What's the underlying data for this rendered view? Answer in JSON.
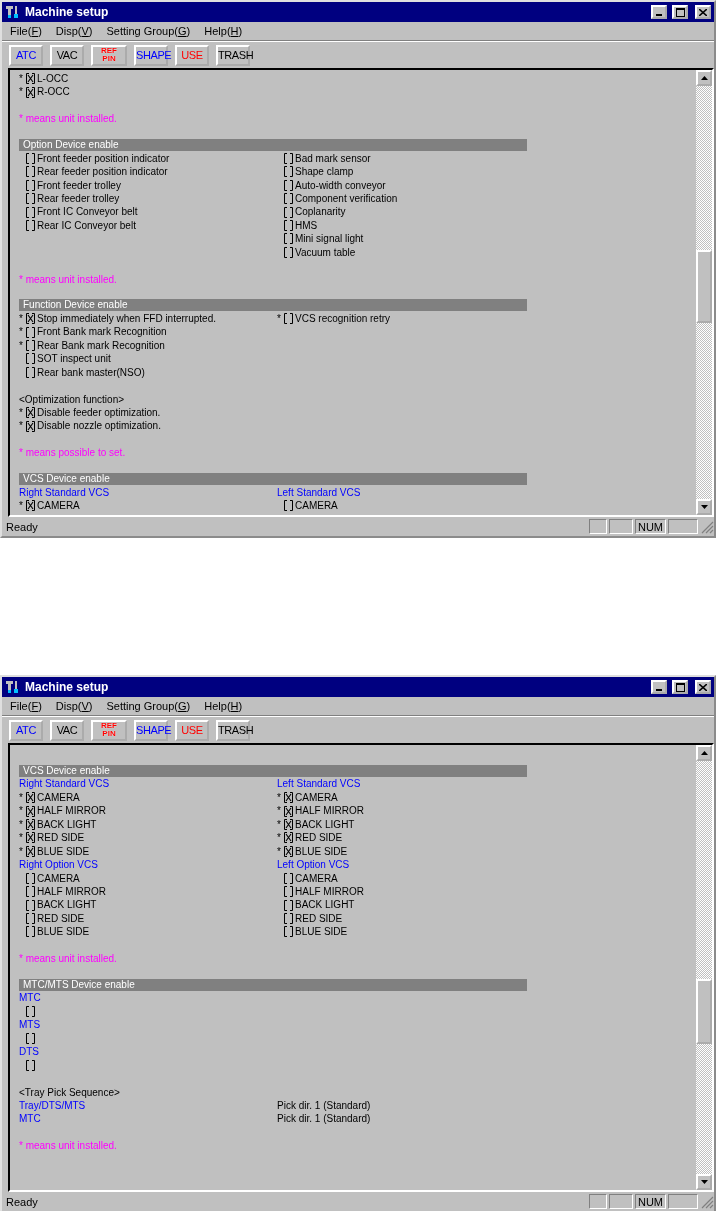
{
  "windows": [
    {
      "title": "Machine setup",
      "menu": [
        {
          "before": "File(",
          "key": "F",
          "after": ")"
        },
        {
          "before": "Disp(",
          "key": "V",
          "after": ")"
        },
        {
          "before": "Setting Group(",
          "key": "G",
          "after": ")"
        },
        {
          "before": "Help(",
          "key": "H",
          "after": ")"
        }
      ],
      "toolbar": [
        {
          "label": "ATC",
          "color": "#0000ff",
          "kind": "plain"
        },
        {
          "label": "VAC",
          "color": "#000000",
          "kind": "plain"
        },
        {
          "label": "REF PIN",
          "color": "#ff0000",
          "kind": "stacked"
        },
        {
          "label": "SHAPE",
          "color": "#0000ff",
          "kind": "plain"
        },
        {
          "label": "USE",
          "color": "#ff0000",
          "kind": "plain"
        },
        {
          "label": "TRASH",
          "color": "#000000",
          "kind": "plain"
        }
      ],
      "blocks": [
        [
          {
            "kind": "row",
            "cells": [
              {
                "kind": "check",
                "mark": "*",
                "checked": true,
                "label": "L-OCC"
              }
            ]
          },
          {
            "kind": "row",
            "cells": [
              {
                "kind": "check",
                "mark": "*",
                "checked": true,
                "label": "R-OCC"
              }
            ]
          }
        ],
        [
          {
            "kind": "row",
            "cells": [
              {
                "kind": "note",
                "text": "* means unit installed."
              }
            ]
          }
        ],
        [
          {
            "kind": "section",
            "title": "Option Device enable"
          },
          {
            "kind": "row",
            "cells": [
              {
                "kind": "check",
                "checked": false,
                "label": "Front feeder position indicator"
              },
              {
                "kind": "check",
                "checked": false,
                "label": "Bad mark sensor"
              }
            ]
          },
          {
            "kind": "row",
            "cells": [
              {
                "kind": "check",
                "checked": false,
                "label": "Rear feeder position indicator"
              },
              {
                "kind": "check",
                "checked": false,
                "label": "Shape clamp"
              }
            ]
          },
          {
            "kind": "row",
            "cells": [
              {
                "kind": "check",
                "checked": false,
                "label": "Front feeder trolley"
              },
              {
                "kind": "check",
                "checked": false,
                "label": "Auto-width conveyor"
              }
            ]
          },
          {
            "kind": "row",
            "cells": [
              {
                "kind": "check",
                "checked": false,
                "label": "Rear feeder trolley"
              },
              {
                "kind": "check",
                "checked": false,
                "label": "Component verification"
              }
            ]
          },
          {
            "kind": "row",
            "cells": [
              {
                "kind": "check",
                "checked": false,
                "label": "Front IC Conveyor belt"
              },
              {
                "kind": "check",
                "checked": false,
                "label": "Coplanarity"
              }
            ]
          },
          {
            "kind": "row",
            "cells": [
              {
                "kind": "check",
                "checked": false,
                "label": "Rear IC Conveyor belt"
              },
              {
                "kind": "check",
                "checked": false,
                "label": "HMS"
              }
            ]
          },
          {
            "kind": "row",
            "cells": [
              {
                "kind": "empty"
              },
              {
                "kind": "check",
                "checked": false,
                "label": "Mini signal light"
              }
            ]
          },
          {
            "kind": "row",
            "cells": [
              {
                "kind": "empty"
              },
              {
                "kind": "check",
                "checked": false,
                "label": "Vacuum table"
              }
            ]
          }
        ],
        [
          {
            "kind": "row",
            "cells": [
              {
                "kind": "note",
                "text": "* means unit installed."
              }
            ]
          }
        ],
        [
          {
            "kind": "section",
            "title": "Function Device enable"
          },
          {
            "kind": "row",
            "cells": [
              {
                "kind": "check",
                "mark": "*",
                "checked": true,
                "label": "Stop immediately when FFD interrupted."
              },
              {
                "kind": "check",
                "mark": "*",
                "checked": false,
                "label": "VCS recognition retry"
              }
            ]
          },
          {
            "kind": "row",
            "cells": [
              {
                "kind": "check",
                "mark": "*",
                "checked": false,
                "label": "Front Bank mark Recognition"
              }
            ]
          },
          {
            "kind": "row",
            "cells": [
              {
                "kind": "check",
                "mark": "*",
                "checked": false,
                "label": "Rear Bank mark Recognition"
              }
            ]
          },
          {
            "kind": "row",
            "cells": [
              {
                "kind": "check",
                "checked": false,
                "label": "SOT inspect unit"
              }
            ]
          },
          {
            "kind": "row",
            "cells": [
              {
                "kind": "check",
                "checked": false,
                "label": "Rear bank master(NSO)"
              }
            ]
          }
        ],
        [
          {
            "kind": "row",
            "cells": [
              {
                "kind": "text",
                "text": "<Optimization function>"
              }
            ]
          },
          {
            "kind": "row",
            "cells": [
              {
                "kind": "check",
                "mark": "*",
                "checked": true,
                "label": "Disable feeder optimization."
              }
            ]
          },
          {
            "kind": "row",
            "cells": [
              {
                "kind": "check",
                "mark": "*",
                "checked": true,
                "label": "Disable nozzle optimization."
              }
            ]
          }
        ],
        [
          {
            "kind": "row",
            "cells": [
              {
                "kind": "note",
                "text": "* means possible to set."
              }
            ]
          }
        ],
        [
          {
            "kind": "section",
            "title": "VCS Device enable"
          },
          {
            "kind": "row",
            "cells": [
              {
                "kind": "label",
                "text": "Right Standard VCS"
              },
              {
                "kind": "label",
                "text": "Left Standard VCS"
              }
            ]
          },
          {
            "kind": "row",
            "cells": [
              {
                "kind": "check",
                "mark": "*",
                "checked": true,
                "label": "CAMERA"
              },
              {
                "kind": "check",
                "checked": false,
                "label": "CAMERA"
              }
            ]
          }
        ]
      ],
      "status_bar": {
        "text": "Ready",
        "indicators": [
          "NUM"
        ]
      }
    },
    {
      "title": "Machine setup",
      "menu": [
        {
          "before": "File(",
          "key": "F",
          "after": ")"
        },
        {
          "before": "Disp(",
          "key": "V",
          "after": ")"
        },
        {
          "before": "Setting Group(",
          "key": "G",
          "after": ")"
        },
        {
          "before": "Help(",
          "key": "H",
          "after": ")"
        }
      ],
      "toolbar": [
        {
          "label": "ATC",
          "color": "#0000ff",
          "kind": "plain"
        },
        {
          "label": "VAC",
          "color": "#000000",
          "kind": "plain"
        },
        {
          "label": "REF PIN",
          "color": "#ff0000",
          "kind": "stacked"
        },
        {
          "label": "SHAPE",
          "color": "#0000ff",
          "kind": "plain"
        },
        {
          "label": "USE",
          "color": "#ff0000",
          "kind": "plain"
        },
        {
          "label": "TRASH",
          "color": "#000000",
          "kind": "plain"
        }
      ],
      "blocks": [
        [
          {
            "kind": "section",
            "title": "VCS Device enable"
          },
          {
            "kind": "row",
            "cells": [
              {
                "kind": "label",
                "text": "Right Standard VCS"
              },
              {
                "kind": "label",
                "text": "Left Standard VCS"
              }
            ]
          },
          {
            "kind": "row",
            "cells": [
              {
                "kind": "check",
                "mark": "*",
                "checked": true,
                "label": "CAMERA"
              },
              {
                "kind": "check",
                "mark": "*",
                "checked": true,
                "label": "CAMERA"
              }
            ]
          },
          {
            "kind": "row",
            "cells": [
              {
                "kind": "check",
                "mark": "*",
                "checked": true,
                "label": "HALF MIRROR"
              },
              {
                "kind": "check",
                "mark": "*",
                "checked": true,
                "label": "HALF MIRROR"
              }
            ]
          },
          {
            "kind": "row",
            "cells": [
              {
                "kind": "check",
                "mark": "*",
                "checked": true,
                "label": "BACK LIGHT"
              },
              {
                "kind": "check",
                "mark": "*",
                "checked": true,
                "label": "BACK LIGHT"
              }
            ]
          },
          {
            "kind": "row",
            "cells": [
              {
                "kind": "check",
                "mark": "*",
                "checked": true,
                "label": "RED SIDE"
              },
              {
                "kind": "check",
                "mark": "*",
                "checked": true,
                "label": "RED SIDE"
              }
            ]
          },
          {
            "kind": "row",
            "cells": [
              {
                "kind": "check",
                "mark": "*",
                "checked": true,
                "label": "BLUE SIDE"
              },
              {
                "kind": "check",
                "mark": "*",
                "checked": true,
                "label": "BLUE SIDE"
              }
            ]
          },
          {
            "kind": "row",
            "cells": [
              {
                "kind": "label",
                "text": "Right Option VCS"
              },
              {
                "kind": "label",
                "text": "Left Option VCS"
              }
            ]
          },
          {
            "kind": "row",
            "cells": [
              {
                "kind": "check",
                "checked": false,
                "label": "CAMERA"
              },
              {
                "kind": "check",
                "checked": false,
                "label": "CAMERA"
              }
            ]
          },
          {
            "kind": "row",
            "cells": [
              {
                "kind": "check",
                "checked": false,
                "label": "HALF MIRROR"
              },
              {
                "kind": "check",
                "checked": false,
                "label": "HALF MIRROR"
              }
            ]
          },
          {
            "kind": "row",
            "cells": [
              {
                "kind": "check",
                "checked": false,
                "label": "BACK LIGHT"
              },
              {
                "kind": "check",
                "checked": false,
                "label": "BACK LIGHT"
              }
            ]
          },
          {
            "kind": "row",
            "cells": [
              {
                "kind": "check",
                "checked": false,
                "label": "RED SIDE"
              },
              {
                "kind": "check",
                "checked": false,
                "label": "RED SIDE"
              }
            ]
          },
          {
            "kind": "row",
            "cells": [
              {
                "kind": "check",
                "checked": false,
                "label": "BLUE SIDE"
              },
              {
                "kind": "check",
                "checked": false,
                "label": "BLUE SIDE"
              }
            ]
          }
        ],
        [
          {
            "kind": "row",
            "cells": [
              {
                "kind": "note",
                "text": "* means unit installed."
              }
            ]
          }
        ],
        [
          {
            "kind": "section",
            "title": "MTC/MTS Device enable"
          },
          {
            "kind": "row",
            "cells": [
              {
                "kind": "label",
                "text": "MTC"
              }
            ]
          },
          {
            "kind": "row",
            "cells": [
              {
                "kind": "check",
                "checked": false
              }
            ]
          },
          {
            "kind": "row",
            "cells": [
              {
                "kind": "label",
                "text": "MTS"
              }
            ]
          },
          {
            "kind": "row",
            "cells": [
              {
                "kind": "check",
                "checked": false
              }
            ]
          },
          {
            "kind": "row",
            "cells": [
              {
                "kind": "label",
                "text": "DTS"
              }
            ]
          },
          {
            "kind": "row",
            "cells": [
              {
                "kind": "check",
                "checked": false
              }
            ]
          }
        ],
        [
          {
            "kind": "row",
            "cells": [
              {
                "kind": "text",
                "text": "<Tray Pick Sequence>"
              }
            ]
          },
          {
            "kind": "row",
            "cells": [
              {
                "kind": "label",
                "text": "Tray/DTS/MTS"
              },
              {
                "kind": "text",
                "text": "Pick dir. 1 (Standard)"
              }
            ]
          },
          {
            "kind": "row",
            "cells": [
              {
                "kind": "label",
                "text": "MTC"
              },
              {
                "kind": "text",
                "text": "Pick dir. 1 (Standard)"
              }
            ]
          }
        ],
        [
          {
            "kind": "row",
            "cells": [
              {
                "kind": "note",
                "text": "* means unit installed."
              }
            ]
          }
        ]
      ],
      "status_bar": {
        "text": "Ready",
        "indicators": [
          "NUM"
        ]
      }
    }
  ]
}
